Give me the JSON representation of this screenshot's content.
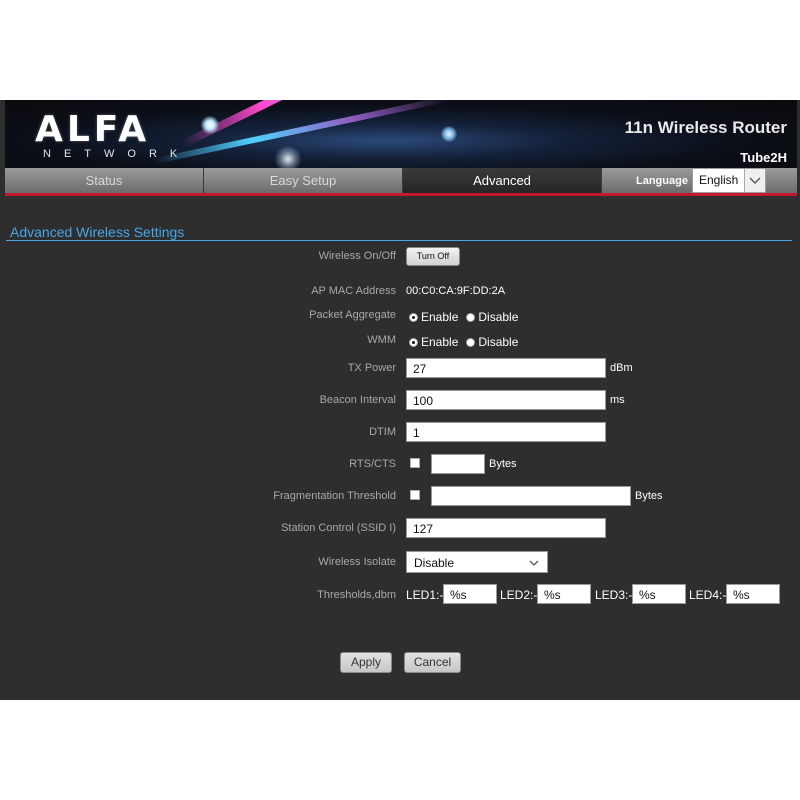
{
  "header": {
    "logo_text": "ALFA",
    "logo_subtext": "NETWORK",
    "product_title": "11n Wireless Router",
    "model": "Tube2H"
  },
  "nav": {
    "tabs": [
      {
        "label": "Status",
        "active": false
      },
      {
        "label": "Easy Setup",
        "active": false
      },
      {
        "label": "Advanced",
        "active": true
      }
    ],
    "language_label": "Language",
    "language_value": "English"
  },
  "section": {
    "title": "Advanced Wireless Settings"
  },
  "form": {
    "wireless_onoff": {
      "label": "Wireless On/Off",
      "button": "Turn Off"
    },
    "ap_mac": {
      "label": "AP MAC Address",
      "value": "00:C0:CA:9F:DD:2A"
    },
    "packet_aggregate": {
      "label": "Packet Aggregate",
      "enable": "Enable",
      "disable": "Disable",
      "selected": "Enable"
    },
    "wmm": {
      "label": "WMM",
      "enable": "Enable",
      "disable": "Disable",
      "selected": "Enable"
    },
    "tx_power": {
      "label": "TX Power",
      "value": "27",
      "unit": "dBm"
    },
    "beacon_interval": {
      "label": "Beacon Interval",
      "value": "100",
      "unit": "ms"
    },
    "dtim": {
      "label": "DTIM",
      "value": "1"
    },
    "rts_cts": {
      "label": "RTS/CTS",
      "value": "",
      "unit": "Bytes",
      "checked": false
    },
    "fragmentation": {
      "label": "Fragmentation Threshold",
      "value": "",
      "unit": "Bytes",
      "checked": false
    },
    "station_control": {
      "label": "Station Control (SSID I)",
      "value": "127"
    },
    "wireless_isolate": {
      "label": "Wireless Isolate",
      "value": "Disable"
    },
    "thresholds": {
      "label": "Thresholds,dbm",
      "led1_label": "LED1:-",
      "led1_value": "%s",
      "led2_label": "LED2:-",
      "led2_value": "%s",
      "led3_label": "LED3:-",
      "led3_value": "%s",
      "led4_label": "LED4:-",
      "led4_value": "%s"
    }
  },
  "actions": {
    "apply": "Apply",
    "cancel": "Cancel"
  },
  "colors": {
    "accent_blue": "#48a6e8",
    "accent_red": "#c3192e",
    "background": "#2e2e2e"
  }
}
